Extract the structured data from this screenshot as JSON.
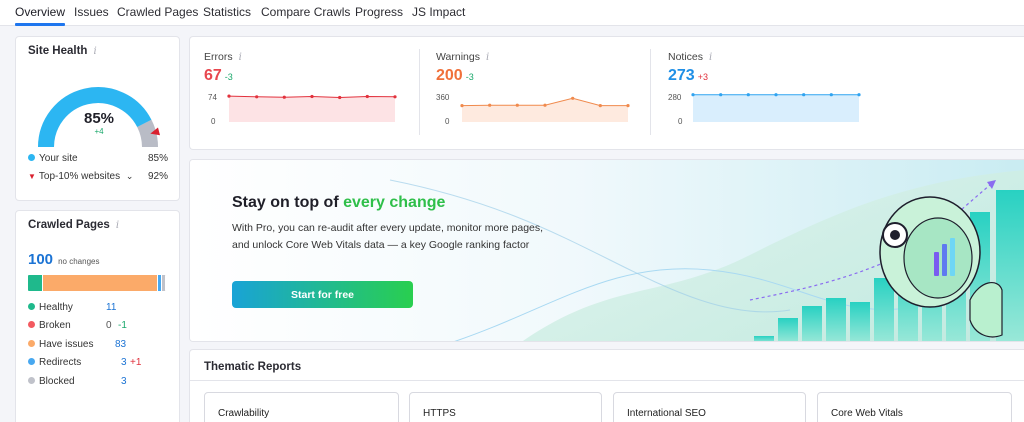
{
  "tabs": [
    "Overview",
    "Issues",
    "Crawled Pages",
    "Statistics",
    "Compare Crawls",
    "Progress",
    "JS Impact"
  ],
  "site_health": {
    "title": "Site Health",
    "info_icon": "i",
    "score": "85%",
    "score_value": 85,
    "delta": "+4",
    "legend": [
      {
        "label": "Your site",
        "value": "85%",
        "color": "#2cb6f2",
        "marker": "dot"
      },
      {
        "label": "Top-10% websites",
        "value": "92%",
        "color": "#d9202e",
        "marker": "triangle",
        "dropdown": "chevron-down-icon"
      }
    ]
  },
  "crawled_pages": {
    "title": "Crawled Pages",
    "info_icon": "i",
    "count": "100",
    "count_note": "no changes",
    "bar_segments": [
      {
        "name": "Healthy",
        "value": 11,
        "color": "#1fb98c"
      },
      {
        "name": "Broken",
        "value": 0,
        "color": "#f35a60"
      },
      {
        "name": "Have issues",
        "value": 83,
        "color": "#fbaa69"
      },
      {
        "name": "Redirects",
        "value": 3,
        "color": "#48a8f0"
      },
      {
        "name": "Blocked",
        "value": 3,
        "color": "#c0c2ca"
      }
    ],
    "rows": [
      {
        "label": "Healthy",
        "value": "11",
        "delta": "",
        "color": "#1fb98c"
      },
      {
        "label": "Broken",
        "value": "0",
        "delta": "-1",
        "delta_color": "#1aa86b",
        "color": "#f35a60"
      },
      {
        "label": "Have issues",
        "value": "83",
        "delta": "",
        "color": "#fbaa69"
      },
      {
        "label": "Redirects",
        "value": "3",
        "delta": "+1",
        "delta_color": "#e0303c",
        "color": "#48a8f0"
      },
      {
        "label": "Blocked",
        "value": "3",
        "delta": "",
        "color": "#c0c2ca"
      }
    ]
  },
  "metrics": [
    {
      "label": "Errors",
      "info_icon": "i",
      "value": "67",
      "delta": "-3",
      "delta_color": "#1aa86b",
      "value_color": "#e8474f",
      "y_max_label": "74",
      "y_min_label": "0",
      "y_max": 74,
      "line_color": "#e2323d",
      "fill_color": "#fde3e5",
      "points": [
        68,
        66,
        65,
        67,
        64,
        67,
        66
      ]
    },
    {
      "label": "Warnings",
      "info_icon": "i",
      "value": "200",
      "delta": "-3",
      "delta_color": "#1aa86b",
      "value_color": "#f0703a",
      "y_max_label": "360",
      "y_min_label": "0",
      "y_max": 360,
      "line_color": "#f08a4d",
      "fill_color": "#feeadf",
      "points": [
        200,
        205,
        205,
        205,
        300,
        200,
        200
      ]
    },
    {
      "label": "Notices",
      "info_icon": "i",
      "value": "273",
      "delta": "+3",
      "delta_color": "#e0303c",
      "value_color": "#1f8fe6",
      "y_max_label": "280",
      "y_min_label": "0",
      "y_max": 280,
      "line_color": "#2fa3f0",
      "fill_color": "#d9eefd",
      "points": [
        272,
        272,
        272,
        272,
        272,
        272,
        273
      ]
    }
  ],
  "promo": {
    "title_prefix": "Stay on top of ",
    "title_highlight": "every change",
    "body": "With Pro, you can re-audit after every update, monitor more pages, and unlock Core Web Vitals data — a key Google ranking factor",
    "button": "Start for free",
    "highlight_color": "#2fbf4a"
  },
  "thematic": {
    "title": "Thematic Reports",
    "reports": [
      "Crawlability",
      "HTTPS",
      "International SEO",
      "Core Web Vitals"
    ]
  }
}
